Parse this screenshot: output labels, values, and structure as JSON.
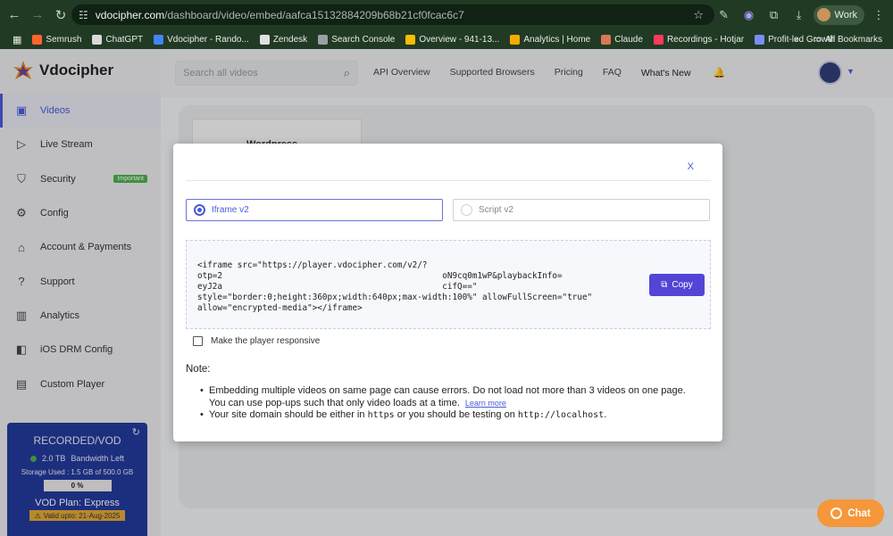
{
  "browser": {
    "url_domain": "vdocipher.com",
    "url_path": "/dashboard/video/embed/aafca15132884209b68b21cf0fcac6c7",
    "profile_label": "Work",
    "bookmarks": [
      {
        "label": "Semrush",
        "color": "#ff642d"
      },
      {
        "label": "ChatGPT",
        "color": "#d9d9d9"
      },
      {
        "label": "Vdocipher - Rando...",
        "color": "#4285f4"
      },
      {
        "label": "Zendesk",
        "color": "#e0e0e0"
      },
      {
        "label": "Search Console",
        "color": "#9aa0a6"
      },
      {
        "label": "Overview - 941-13...",
        "color": "#fbbc04"
      },
      {
        "label": "Analytics | Home",
        "color": "#f9ab00"
      },
      {
        "label": "Claude",
        "color": "#d97757"
      },
      {
        "label": "Recordings - Hotjar",
        "color": "#fd3a5c"
      },
      {
        "label": "Profit-led Growth",
        "color": "#7b8cff"
      }
    ],
    "all_bookmarks": "All Bookmarks"
  },
  "brand": {
    "name": "Vdocipher"
  },
  "sidebar": {
    "items": [
      {
        "label": "Videos",
        "icon": "video-icon"
      },
      {
        "label": "Live Stream",
        "icon": "live-stream-icon"
      },
      {
        "label": "Security",
        "icon": "shield-icon",
        "badge": "Important"
      },
      {
        "label": "Config",
        "icon": "gear-icon"
      },
      {
        "label": "Account & Payments",
        "icon": "bank-icon"
      },
      {
        "label": "Support",
        "icon": "help-icon"
      },
      {
        "label": "Analytics",
        "icon": "analytics-icon"
      },
      {
        "label": "iOS DRM Config",
        "icon": "ios-icon"
      },
      {
        "label": "Custom Player",
        "icon": "player-icon"
      }
    ]
  },
  "plan": {
    "title": "RECORDED/VOD",
    "bandwidth": "2.0 TB",
    "bandwidth_label": "Bandwidth Left",
    "storage": "Storage Used : 1.5 GB of 500.0 GB",
    "usage_percent": "0 %",
    "plan_name": "VOD Plan: Express",
    "valid": "Valid upto: 21-Aug-2025"
  },
  "topnav": {
    "search_placeholder": "Search all videos",
    "links": [
      "API Overview",
      "Supported Browsers",
      "Pricing",
      "FAQ"
    ],
    "whats_new": "What's New"
  },
  "background": {
    "card_title": "Wordpress"
  },
  "modal": {
    "close": "X",
    "options": [
      "Iframe v2",
      "Script v2"
    ],
    "code": "<iframe src=\"https://player.vdocipher.com/v2/?\notp=2                                            oN9cq0m1wP&playbackInfo=\neyJ2a                                            cifQ==\"\nstyle=\"border:0;height:360px;width:640px;max-width:100%\" allowFullScreen=\"true\"\nallow=\"encrypted-media\"></iframe>",
    "copy_label": "Copy",
    "responsive_label": "Make the player responsive",
    "note_title": "Note:",
    "note1": "Embedding multiple videos on same page can cause errors. Do not load not more than 3 videos on one page. You can use pop-ups such that only video loads at a time.",
    "learn_more": "Learn more",
    "note2_a": "Your site domain should be either in",
    "note2_code1": "https",
    "note2_b": "or you should be testing on",
    "note2_code2": "http://localhost",
    "note2_c": "."
  },
  "chat": {
    "label": "Chat"
  }
}
